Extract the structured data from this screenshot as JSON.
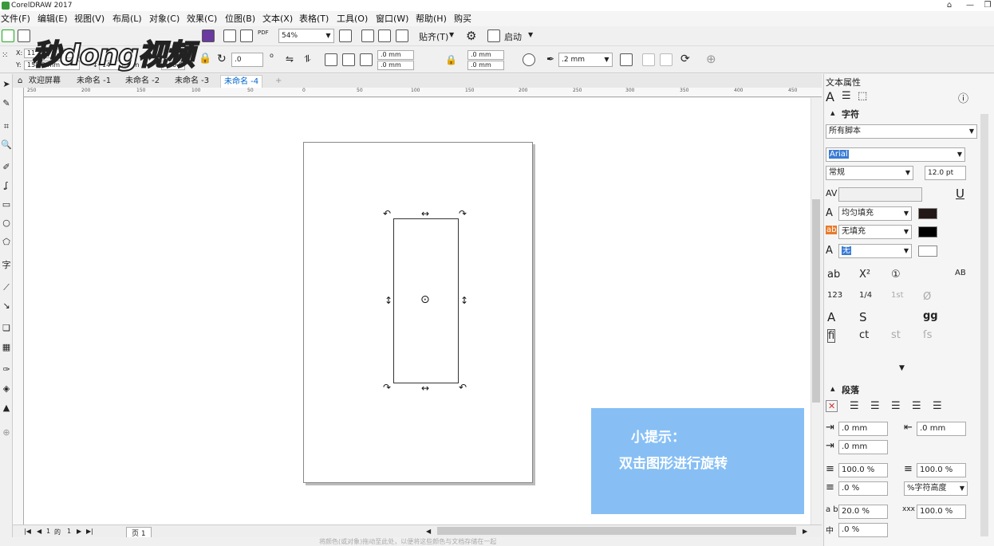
{
  "window": {
    "title": "CorelDRAW 2017",
    "min_label": "—",
    "restore_label": "❐"
  },
  "menu": [
    "文件(F)",
    "编辑(E)",
    "视图(V)",
    "布局(L)",
    "对象(C)",
    "效果(C)",
    "位图(B)",
    "文本(X)",
    "表格(T)",
    "工具(O)",
    "窗口(W)",
    "帮助(H)",
    "购买"
  ],
  "toolbar": {
    "zoom": "54%",
    "snap_label": "贴齐(T)",
    "launch_label": "启动",
    "pdf_label": "PDF"
  },
  "propbar": {
    "x_label": "X:",
    "x_value": "11",
    "y_label": "Y:",
    "y_value": "158.0 mm",
    "w_value": "14",
    "w_unit": "mm",
    "scale_value": "100.0",
    "pct": "%",
    "pct2": "%",
    "angle_value": ".0",
    "deg": "o",
    "corner1": ".0 mm",
    "corner2": ".0 mm",
    "corner3": ".0 mm",
    "corner4": ".0 mm",
    "outline_width": ".2 mm"
  },
  "watermark": "秒dong视频",
  "tabs": [
    "欢迎屏幕",
    "未命名 -1",
    "未命名 -2",
    "未命名 -3",
    "未命名 -4"
  ],
  "active_tab": 4,
  "ruler_ticks": [
    "250",
    "200",
    "150",
    "100",
    "50",
    "0",
    "50",
    "100",
    "150",
    "200",
    "250",
    "300",
    "350",
    "400",
    "450"
  ],
  "hint": {
    "title": "小提示：",
    "body": "双击图形进行旋转"
  },
  "bottom": {
    "page_num": "1",
    "of_label": "的",
    "page_total": "1",
    "page_tab": "页 1"
  },
  "statusbar": {
    "hint": "将颜色(或对象)拖动至此处，以便将这些颜色与文档存储在一起"
  },
  "panel": {
    "title": "文本属性",
    "char_section": "字符",
    "script": "所有脚本",
    "font": "Arial",
    "style": "常规",
    "size": "12.0 pt",
    "fill1": "均匀填充",
    "fill2": "无填充",
    "outline": "无",
    "para_section": "段落",
    "indent1": ".0 mm",
    "indent2": ".0 mm",
    "indent3": ".0 mm",
    "spacing1": "100.0 %",
    "spacing2": "100.0 %",
    "spacing3": ".0 %",
    "line_unit": "%字符高度",
    "char_spacing": "20.0 %",
    "word_spacing": "100.0 %",
    "lang_spacing": ".0 %",
    "glyph_ab": "AB",
    "glyph_123": "123",
    "glyph_frac": "1/4",
    "glyph_1st": "1st"
  },
  "colors": {
    "hint_bg": "#87bff5",
    "accent": "#0066cc",
    "swatch": "#231815"
  }
}
